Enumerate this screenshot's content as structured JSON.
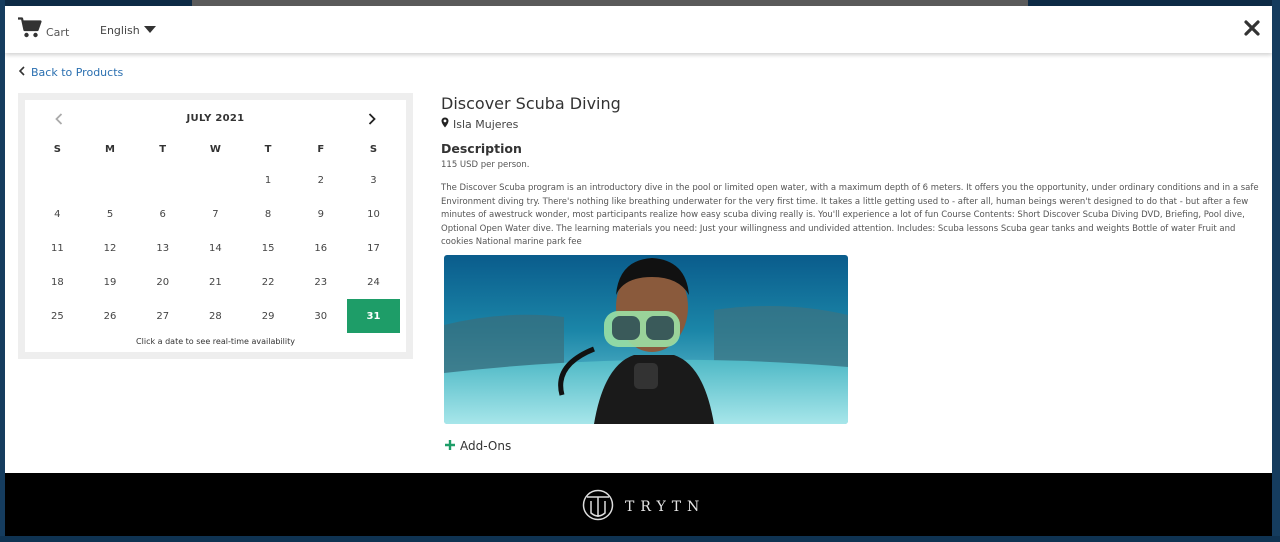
{
  "topbar": {
    "cart_label": "Cart",
    "language": "English"
  },
  "back_link": "Back to Products",
  "calendar": {
    "month_title": "JULY 2021",
    "weekdays": [
      "S",
      "M",
      "T",
      "W",
      "T",
      "F",
      "S"
    ],
    "weeks": [
      [
        "",
        "",
        "",
        "",
        "1",
        "2",
        "3"
      ],
      [
        "4",
        "5",
        "6",
        "7",
        "8",
        "9",
        "10"
      ],
      [
        "11",
        "12",
        "13",
        "14",
        "15",
        "16",
        "17"
      ],
      [
        "18",
        "19",
        "20",
        "21",
        "22",
        "23",
        "24"
      ],
      [
        "25",
        "26",
        "27",
        "28",
        "29",
        "30",
        "31"
      ]
    ],
    "selected_day": "31",
    "note": "Click a date to see real-time availability"
  },
  "product": {
    "title": "Discover Scuba Diving",
    "location": "Isla Mujeres",
    "description_heading": "Description",
    "price": "115 USD per person.",
    "description": "The Discover Scuba program is an introductory dive in the pool or limited open water, with a maximum depth of 6 meters. It offers you the opportunity, under ordinary conditions and in a safe Environment diving try. There's nothing like breathing underwater for the very first time. It takes a little getting used to - after all, human beings weren't designed to do that - but after a few minutes of awestruck wonder, most participants realize how easy scuba diving really is. You'll experience a lot of fun Course Contents: Short Discover Scuba Diving DVD, Briefing, Pool dive, Optional Open Water dive. The learning materials you need: Just your willingness and undivided attention. Includes: Scuba lessons Scuba gear tanks and weights Bottle of water Fruit and cookies National marine park fee",
    "addons_label": "Add-Ons"
  },
  "footer": {
    "brand": "TRYTN"
  },
  "colors": {
    "accent": "#1e9d68",
    "link": "#2a6fb0",
    "footer_bg": "#000000"
  },
  "icons": [
    "cart-icon",
    "caret-down-icon",
    "close-icon",
    "chevron-left-icon",
    "chevron-right-icon",
    "map-pin-icon",
    "plus-icon",
    "trytn-logo"
  ]
}
